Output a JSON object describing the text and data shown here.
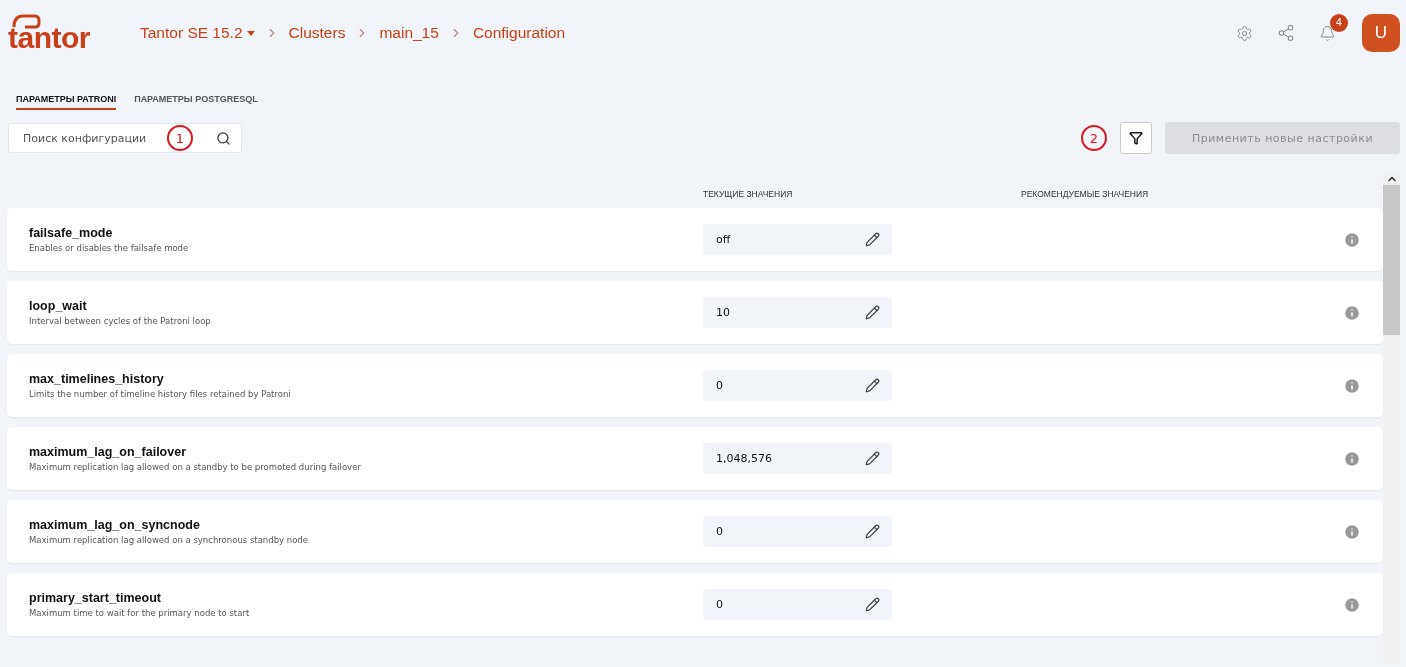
{
  "logo": {
    "text": "tantor"
  },
  "breadcrumbs": [
    {
      "label": "Tantor SE 15.2",
      "kind": "dropdown"
    },
    {
      "label": "Clusters",
      "kind": "link"
    },
    {
      "label": "main_15",
      "kind": "link"
    },
    {
      "label": "Configuration",
      "kind": "link"
    }
  ],
  "header": {
    "notifications": "4",
    "avatar": "U"
  },
  "tabs": [
    {
      "label": "ПАРАМЕТРЫ PATRONI",
      "selected": true
    },
    {
      "label": "ПАРАМЕТРЫ POSTGRESQL",
      "selected": false
    }
  ],
  "search": {
    "placeholder": "Поиск конфигурации"
  },
  "annotations": [
    "1",
    "2"
  ],
  "apply_button": {
    "label": "Применить новые настройки",
    "disabled": true
  },
  "columns": [
    "ТЕКУЩИЕ ЗНАЧЕНИЯ",
    "РЕКОМЕНДУЕМЫЕ ЗНАЧЕНИЯ"
  ],
  "params": [
    {
      "name": "failsafe_mode",
      "description": "Enables or disables the failsafe mode",
      "value": "off"
    },
    {
      "name": "loop_wait",
      "description": "Interval between cycles of the Patroni loop",
      "value": "10"
    },
    {
      "name": "max_timelines_history",
      "description": "Limits the number of timeline history files retained by Patroni",
      "value": "0"
    },
    {
      "name": "maximum_lag_on_failover",
      "description": "Maximum replication lag allowed on a standby to be promoted during failover",
      "value": "1,048,576"
    },
    {
      "name": "maximum_lag_on_syncnode",
      "description": "Maximum replication lag allowed on a synchronous standby node",
      "value": "0"
    },
    {
      "name": "primary_start_timeout",
      "description": "Maximum time to wait for the primary node to start",
      "value": "0"
    }
  ]
}
